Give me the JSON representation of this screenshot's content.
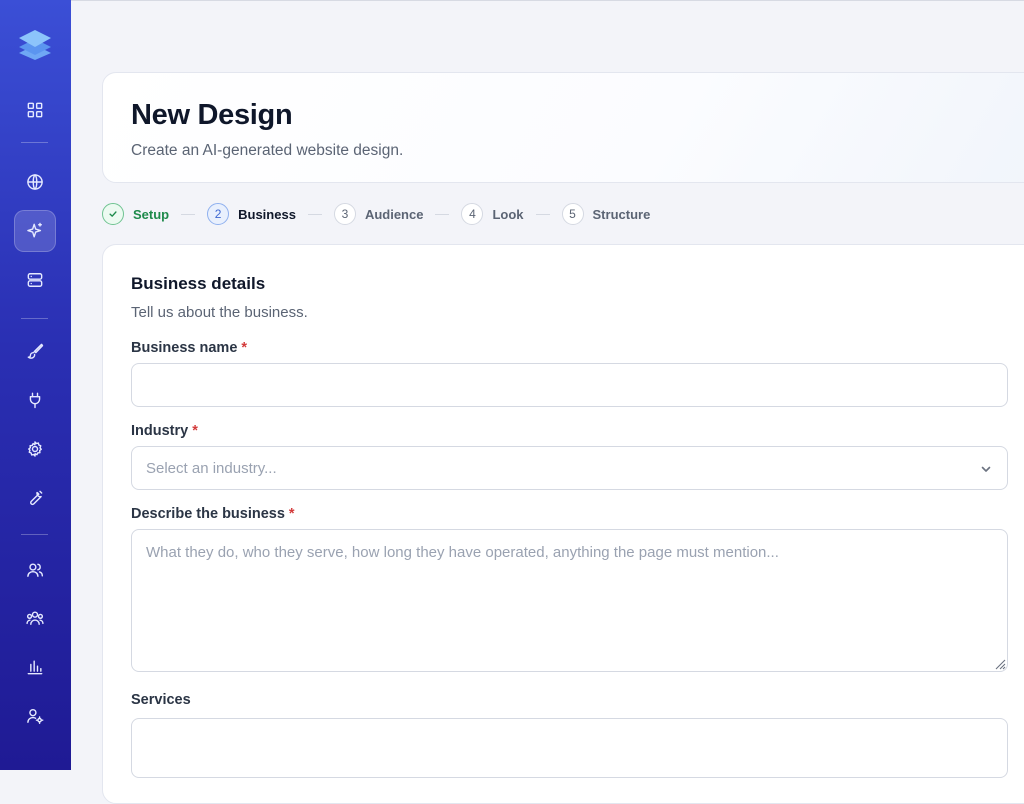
{
  "sidebar": {
    "logo": "layers-logo-icon",
    "items": [
      {
        "icon": "grid-icon",
        "active": false
      },
      {
        "icon": "globe-icon",
        "active": false
      },
      {
        "icon": "sparkle-icon",
        "active": true
      },
      {
        "icon": "server-icon",
        "active": false
      },
      {
        "icon": "brush-icon",
        "active": false
      },
      {
        "icon": "plug-icon",
        "active": false
      },
      {
        "icon": "gear-icon",
        "active": false
      },
      {
        "icon": "wrench-icon",
        "active": false
      },
      {
        "icon": "users-icon",
        "active": false
      },
      {
        "icon": "team-icon",
        "active": false
      },
      {
        "icon": "bar-chart-icon",
        "active": false
      },
      {
        "icon": "user-settings-icon",
        "active": false
      }
    ]
  },
  "header": {
    "title": "New Design",
    "subtitle": "Create an AI-generated website design."
  },
  "stepper": {
    "steps": [
      {
        "number": "✓",
        "label": "Setup",
        "state": "done"
      },
      {
        "number": "2",
        "label": "Business",
        "state": "current"
      },
      {
        "number": "3",
        "label": "Audience",
        "state": "upcoming"
      },
      {
        "number": "4",
        "label": "Look",
        "state": "upcoming"
      },
      {
        "number": "5",
        "label": "Structure",
        "state": "upcoming"
      }
    ]
  },
  "form": {
    "section_title": "Business details",
    "section_desc": "Tell us about the business.",
    "required_mark": "*",
    "business_name": {
      "label": "Business name",
      "value": "",
      "placeholder": ""
    },
    "industry": {
      "label": "Industry",
      "placeholder": "Select an industry..."
    },
    "description": {
      "label": "Describe the business",
      "value": "",
      "placeholder": "What they do, who they serve, how long they have operated, anything the page must mention..."
    },
    "services": {
      "label": "Services",
      "value": "",
      "placeholder": ""
    }
  },
  "colors": {
    "sidebar_top": "#3b4fd6",
    "sidebar_bottom": "#1f1a94",
    "done_green": "#1e8a4b",
    "current_blue": "#3e68d2",
    "required_red": "#d33b3b"
  }
}
